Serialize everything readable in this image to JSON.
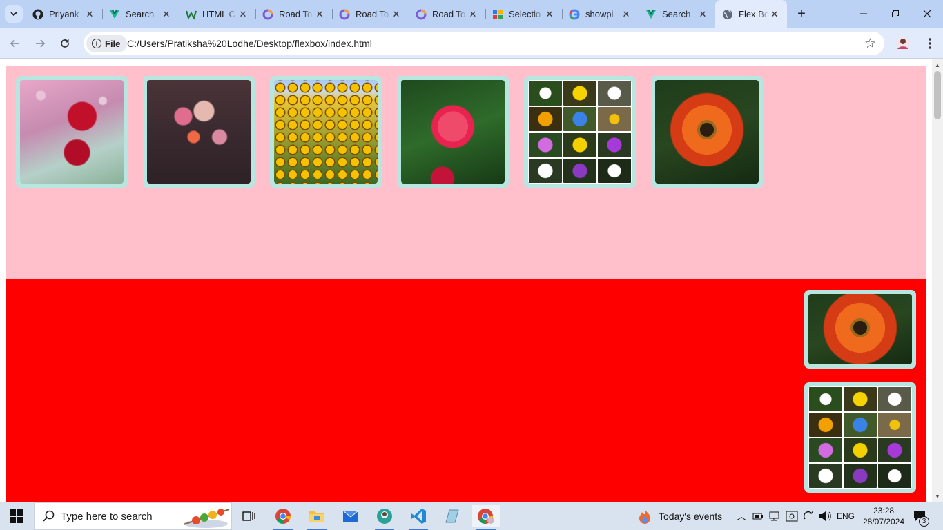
{
  "browser": {
    "tabs": [
      {
        "label": "Priyank",
        "icon": "github-icon"
      },
      {
        "label": "Search",
        "icon": "vue-icon"
      },
      {
        "label": "HTML C",
        "icon": "w-icon"
      },
      {
        "label": "Road To",
        "icon": "roadmap-icon"
      },
      {
        "label": "Road To",
        "icon": "roadmap-icon"
      },
      {
        "label": "Road To",
        "icon": "roadmap-icon"
      },
      {
        "label": "Selectio",
        "icon": "grid-icon"
      },
      {
        "label": "showpi",
        "icon": "google-icon"
      },
      {
        "label": "Search",
        "icon": "vue-icon"
      },
      {
        "label": "Flex Bo",
        "icon": "globe-icon",
        "active": true
      }
    ],
    "address": {
      "chip_label": "File",
      "url": "C:/Users/Pratiksha%20Lodhe/Desktop/flexbox/index.html"
    }
  },
  "page": {
    "section1": {
      "background": "pink",
      "images": [
        "red-roses",
        "dahlias",
        "sunflower-field",
        "red-white-rose",
        "flower-collage",
        "gazania"
      ]
    },
    "section2": {
      "background": "red",
      "images": [
        "gazania",
        "flower-collage"
      ]
    }
  },
  "taskbar": {
    "search_placeholder": "Type here to search",
    "weather_label": "Today's events",
    "language": "ENG",
    "time": "23:28",
    "date": "28/07/2024",
    "notification_count": "3"
  },
  "colors": {
    "tabbar": "#bcd2f5",
    "section1": "#ffc0cb",
    "section2": "#ff0000",
    "card_border": "#b7e6e0"
  }
}
